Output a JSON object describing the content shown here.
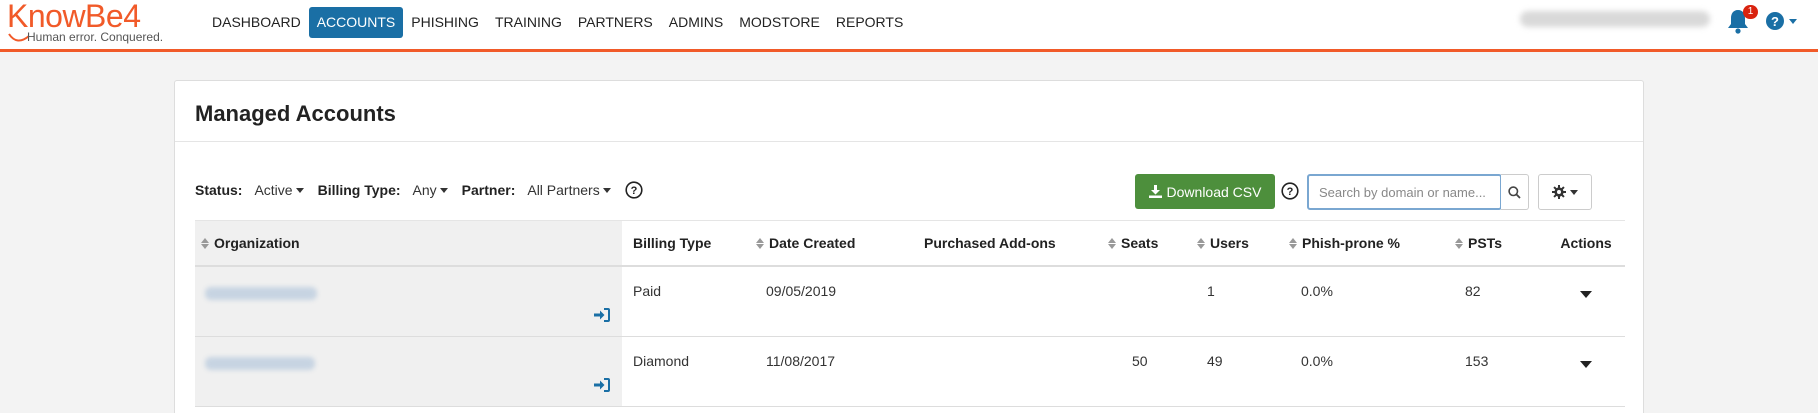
{
  "brand": {
    "name": "KnowBe4",
    "tagline": "Human error. Conquered."
  },
  "nav": {
    "items": [
      {
        "label": "DASHBOARD",
        "active": false
      },
      {
        "label": "ACCOUNTS",
        "active": true
      },
      {
        "label": "PHISHING",
        "active": false
      },
      {
        "label": "TRAINING",
        "active": false
      },
      {
        "label": "PARTNERS",
        "active": false
      },
      {
        "label": "ADMINS",
        "active": false
      },
      {
        "label": "MODSTORE",
        "active": false
      },
      {
        "label": "REPORTS",
        "active": false
      }
    ],
    "notification_count": "1"
  },
  "page": {
    "title": "Managed Accounts"
  },
  "filters": {
    "status_label": "Status:",
    "status_value": "Active",
    "billing_label": "Billing Type:",
    "billing_value": "Any",
    "partner_label": "Partner:",
    "partner_value": "All Partners"
  },
  "toolbar": {
    "download_label": "Download CSV",
    "search_placeholder": "Search by domain or name..."
  },
  "table": {
    "headers": {
      "organization": "Organization",
      "billing_type": "Billing Type",
      "date_created": "Date Created",
      "addons": "Purchased Add-ons",
      "seats": "Seats",
      "users": "Users",
      "phish_prone": "Phish-prone %",
      "psts": "PSTs",
      "actions": "Actions"
    },
    "rows": [
      {
        "billing_type": "Paid",
        "date_created": "09/05/2019",
        "addons": "",
        "seats": "",
        "users": "1",
        "phish_prone": "0.0%",
        "psts": "82"
      },
      {
        "billing_type": "Diamond",
        "date_created": "11/08/2017",
        "addons": "",
        "seats": "50",
        "users": "49",
        "phish_prone": "0.0%",
        "psts": "153"
      }
    ]
  },
  "colors": {
    "brand_orange": "#f15a29",
    "nav_active": "#1a6fa5",
    "csv_green": "#4d8f3c",
    "icon_blue": "#1a6fa5"
  }
}
